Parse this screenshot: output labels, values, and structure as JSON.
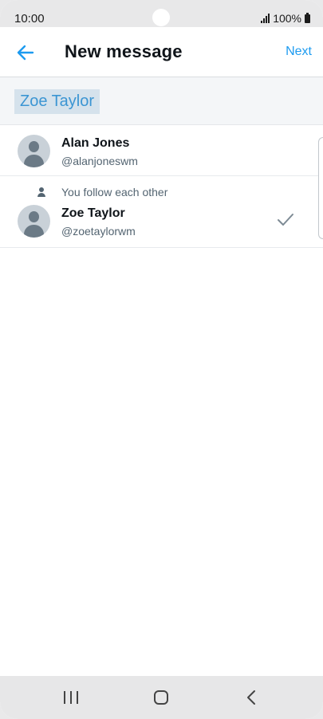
{
  "status_bar": {
    "time": "10:00",
    "battery": "100%"
  },
  "header": {
    "back_icon": "arrow-left-icon",
    "title": "New message",
    "next_label": "Next"
  },
  "search": {
    "recipient_chip": "Zoe Taylor"
  },
  "users": [
    {
      "name": "Alan Jones",
      "handle": "@alanjoneswm",
      "selected": false
    },
    {
      "note": "You follow each other",
      "name": "Zoe Taylor",
      "handle": "@zoetaylorwm",
      "selected": true
    }
  ],
  "nav_bar": {
    "recents_icon": "recents-icon",
    "home_icon": "home-icon",
    "back_icon": "nav-back-icon"
  },
  "colors": {
    "accent": "#1d9bf0",
    "chip_bg": "#d5e2ec",
    "chip_text": "#3b95d3",
    "text_primary": "#0f1419",
    "text_secondary": "#536471"
  }
}
